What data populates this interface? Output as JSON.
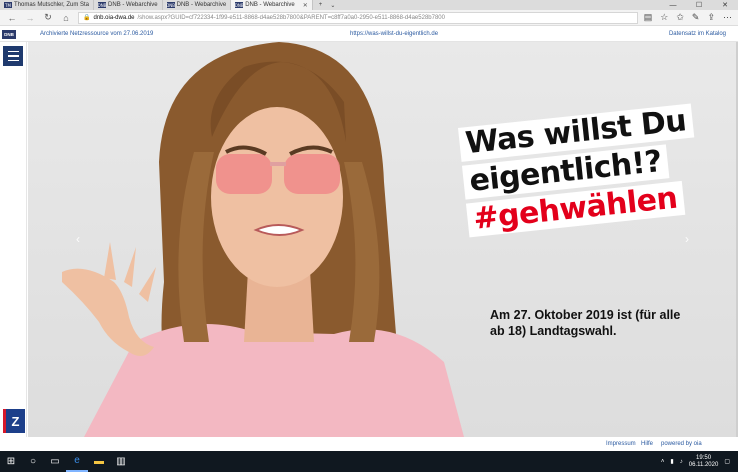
{
  "browser": {
    "tabs": [
      {
        "label": "Thomas Mutschler, Zum Sta",
        "favicon": "TM",
        "active": false
      },
      {
        "label": "DNB - Webarchive",
        "favicon": "DNB",
        "active": false
      },
      {
        "label": "DNB - Webarchive",
        "favicon": "DNB",
        "active": false
      },
      {
        "label": "DNB - Webarchive",
        "favicon": "DNB",
        "active": true
      }
    ],
    "url_host": "dnb.oia-dwa.de",
    "url_rest": "/show.aspx?GUID=cf722334-1f99-e511-8868-d4ae528b7800&PARENT=c8ff7a0a0-2950-e511-8868-d4ae528b7800"
  },
  "dnb": {
    "logo": "DNB",
    "archived_label": "Archivierte Netzressource vom 27.06.2019",
    "archived_url": "https://was-willst-du-eigentlich.de",
    "catalog_link": "Datensatz im Katalog"
  },
  "page": {
    "headline_line1": "Was willst Du",
    "headline_line2": "eigentlich!?",
    "headline_line3": "#gehwählen",
    "subline": "Am 27. Oktober 2019 ist (für alle ab 18) Landtagswahl.",
    "badge": "Z",
    "arrow_prev": "‹",
    "arrow_next": "›"
  },
  "footer": {
    "impressum": "Impressum",
    "hilfe": "Hilfe",
    "powered": "powered by oia"
  },
  "taskbar": {
    "time": "19:50",
    "date": "06.11.2020"
  },
  "colors": {
    "accent_red": "#e3001b",
    "dnb_blue": "#2b3a6b",
    "link_blue": "#2b5aa0"
  }
}
